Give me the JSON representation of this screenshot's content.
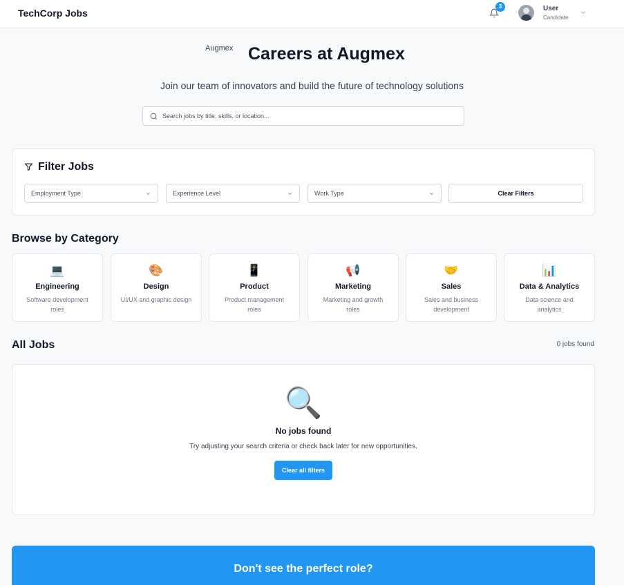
{
  "header": {
    "brand": "TechCorp Jobs",
    "notification_count": "3",
    "user": {
      "name": "User",
      "role": "Candidate"
    }
  },
  "hero": {
    "logo_alt": "Augmex",
    "title": "Careers at Augmex",
    "subtitle": "Join our team of innovators and build the future of technology solutions",
    "search_placeholder": "Search jobs by title, skills, or location..."
  },
  "filters": {
    "title": "Filter Jobs",
    "selects": [
      "Employment Type",
      "Experience Level",
      "Work Type"
    ],
    "clear_label": "Clear Filters"
  },
  "categories": {
    "title": "Browse by Category",
    "items": [
      {
        "icon": "💻",
        "icon_name": "laptop-icon",
        "title": "Engineering",
        "desc": "Software development roles"
      },
      {
        "icon": "🎨",
        "icon_name": "palette-icon",
        "title": "Design",
        "desc": "UI/UX and graphic design"
      },
      {
        "icon": "📱",
        "icon_name": "phone-icon",
        "title": "Product",
        "desc": "Product management roles"
      },
      {
        "icon": "📢",
        "icon_name": "megaphone-icon",
        "title": "Marketing",
        "desc": "Marketing and growth roles"
      },
      {
        "icon": "🤝",
        "icon_name": "handshake-icon",
        "title": "Sales",
        "desc": "Sales and business development"
      },
      {
        "icon": "📊",
        "icon_name": "bar-chart-icon",
        "title": "Data & Analytics",
        "desc": "Data science and analytics"
      }
    ]
  },
  "jobs": {
    "title": "All Jobs",
    "count": "0 jobs found",
    "empty": {
      "icon": "🔍",
      "title": "No jobs found",
      "text": "Try adjusting your search criteria or check back later for new opportunities.",
      "button": "Clear all filters"
    }
  },
  "cta": {
    "title": "Don't see the perfect role?"
  },
  "colors": {
    "accent": "#2196f3",
    "background": "#f8f9fb"
  }
}
